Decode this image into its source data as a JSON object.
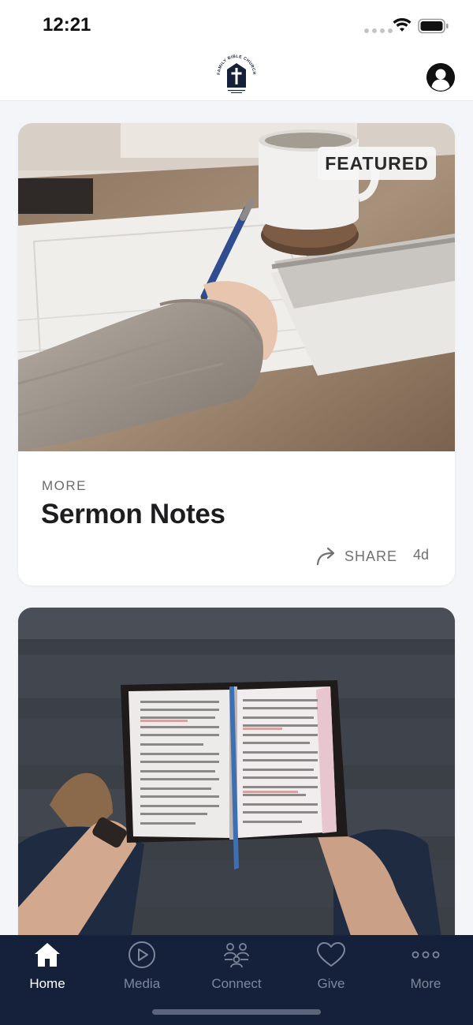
{
  "status_bar": {
    "time": "12:21"
  },
  "header": {
    "logo_text": "FAMILY BIBLE CHURCH",
    "profile_icon": "person-circle-icon"
  },
  "feed": {
    "cards": [
      {
        "badge": "FEATURED",
        "category": "MORE",
        "title": "Sermon Notes",
        "share_label": "SHARE",
        "age": "4d",
        "image": "person-writing-notes-photo"
      },
      {
        "image": "person-reading-bible-photo"
      }
    ]
  },
  "tab_bar": {
    "tabs": [
      {
        "label": "Home",
        "icon": "home-icon",
        "active": true
      },
      {
        "label": "Media",
        "icon": "play-circle-icon",
        "active": false
      },
      {
        "label": "Connect",
        "icon": "people-icon",
        "active": false
      },
      {
        "label": "Give",
        "icon": "heart-icon",
        "active": false
      },
      {
        "label": "More",
        "icon": "more-dots-icon",
        "active": false
      }
    ]
  },
  "colors": {
    "tab_bar_bg": "#15213a",
    "tab_active": "#ffffff",
    "tab_inactive": "#7c879c",
    "background": "#f3f5f9"
  }
}
